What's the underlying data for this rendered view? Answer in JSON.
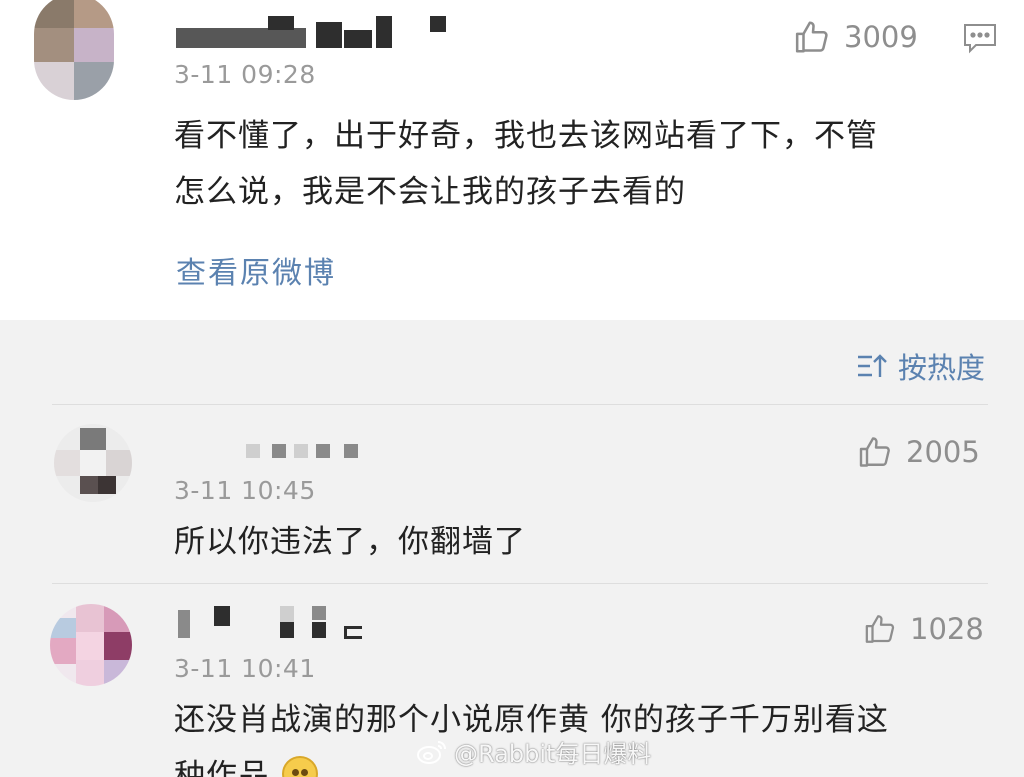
{
  "top_comment": {
    "time": "3-11 09:28",
    "likes": "3009",
    "text_line1": "看不懂了，出于好奇，我也去该网站看了下，不管",
    "text_line2": "怎么说，我是不会让我的孩子去看的",
    "view_original": "查看原微博"
  },
  "sort": {
    "label": "按热度"
  },
  "replies": [
    {
      "time": "3-11 10:45",
      "likes": "2005",
      "text_line1": "所以你违法了，你翻墙了"
    },
    {
      "time": "3-11 10:41",
      "likes": "1028",
      "text_line1": "还没肖战演的那个小说原作黄 你的孩子千万别看这",
      "text_line2": "种作品"
    }
  ],
  "watermark": {
    "text": "@Rabbit每日爆料"
  },
  "colors": {
    "link": "#5b82b0",
    "muted": "#9a9a9a",
    "background": "#f2f2f2",
    "card": "#ffffff"
  },
  "icons": [
    "thumbs-up-icon",
    "comment-icon",
    "sort-icon",
    "weibo-logo-icon",
    "blush-emoji-icon"
  ]
}
